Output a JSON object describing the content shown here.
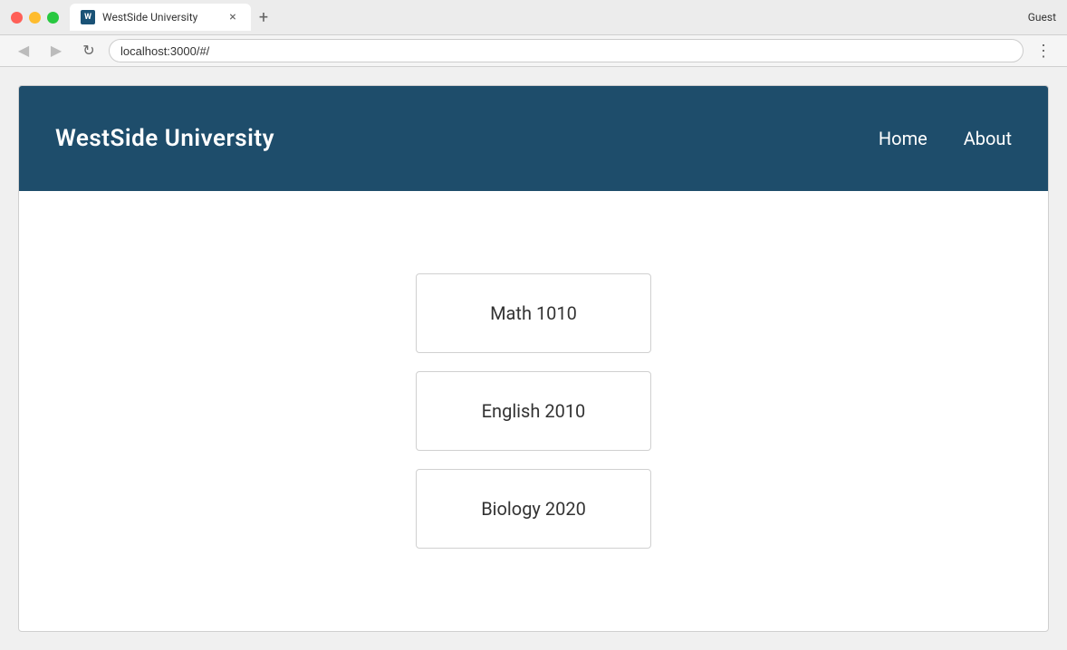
{
  "browser": {
    "tab_title": "WestSide University",
    "url": "localhost:3000/#/",
    "user": "Guest",
    "favicon_text": "W",
    "back_icon": "◀",
    "forward_icon": "▶",
    "reload_icon": "↻",
    "menu_icon": "⋮",
    "close_icon": "×",
    "new_tab_icon": "+"
  },
  "nav": {
    "logo": "WestSide University",
    "links": [
      {
        "label": "Home",
        "href": "#"
      },
      {
        "label": "About",
        "href": "#"
      }
    ]
  },
  "courses": [
    {
      "name": "Math 1010"
    },
    {
      "name": "English 2010"
    },
    {
      "name": "Biology 2020"
    }
  ]
}
